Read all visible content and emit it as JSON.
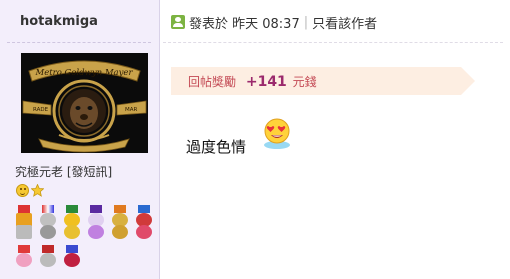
{
  "user": {
    "username": "hotakmiga",
    "rank": "究極元老",
    "pm_link": "[發短訊]",
    "avatar_text": "Metro Goldwyn Mayer",
    "avatar_side_left": "RADE",
    "avatar_side_right": "MAR"
  },
  "post": {
    "posted_at": "發表於 昨天 08:37",
    "author_only": "只看該作者",
    "reward_label": "回帖獎勵",
    "reward_amount": "+141",
    "reward_unit": "元錢",
    "message": "過度色情"
  },
  "icons": {
    "post_icon": "user-post-icon",
    "emoji": "heart-eyes-smiley-icon"
  },
  "colors": {
    "sidebar_bg": "#f3eefb",
    "reward_bg": "#fdeee2",
    "reward_text": "#c44a55",
    "reward_amount": "#9b2a6d",
    "post_icon_green": "#7cb342"
  }
}
